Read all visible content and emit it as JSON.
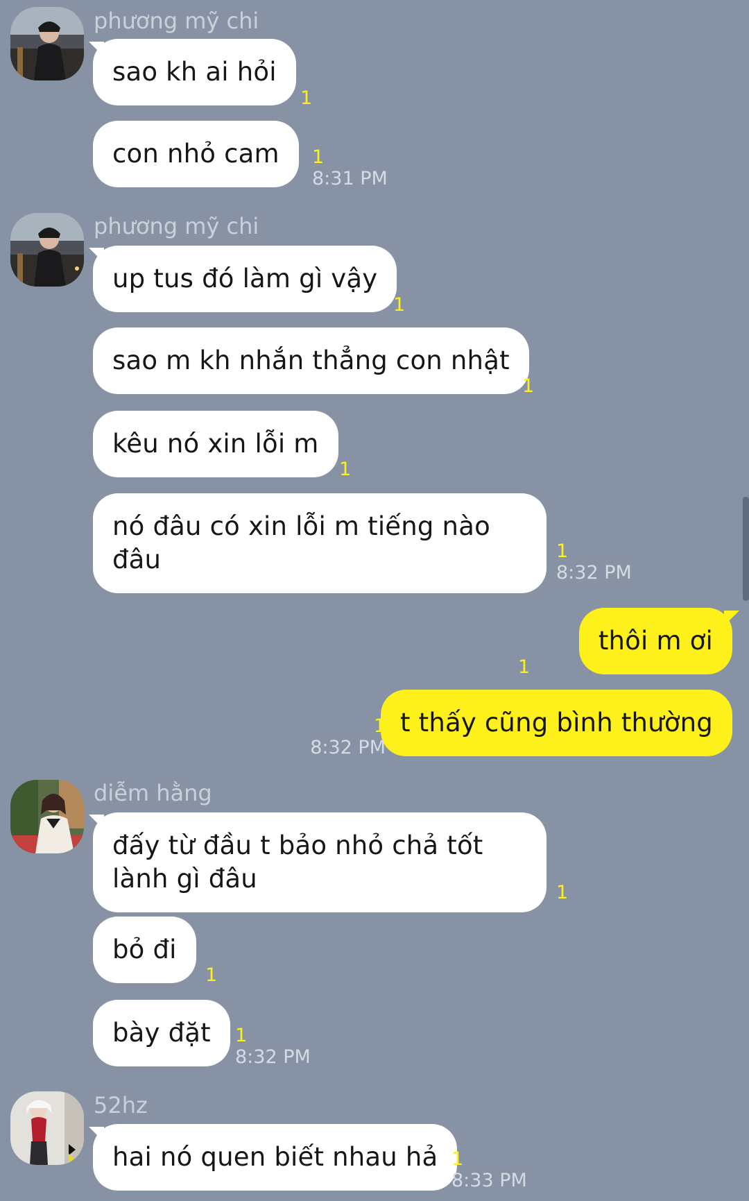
{
  "messages": [
    {
      "sender": "phương mỹ chi",
      "bubbles": [
        {
          "text": "sao kh ai hỏi",
          "unread": "1"
        },
        {
          "text": "con nhỏ cam",
          "unread": "1",
          "time": "8:31 PM"
        }
      ]
    },
    {
      "sender": "phương mỹ chi",
      "bubbles": [
        {
          "text": "up tus đó làm gì vậy",
          "unread": "1"
        },
        {
          "text": "sao m kh nhắn thẳng con nhật",
          "unread": "1"
        },
        {
          "text": "kêu nó xin lỗi m",
          "unread": "1"
        },
        {
          "text": "nó đâu có xin lỗi m tiếng nào đâu",
          "unread": "1",
          "time": "8:32 PM"
        }
      ]
    },
    {
      "sender": "me",
      "bubbles": [
        {
          "text": "thôi m ơi",
          "unread": "1"
        },
        {
          "text": "t thấy cũng bình thường",
          "unread": "1",
          "time": "8:32 PM"
        }
      ]
    },
    {
      "sender": "diễm hằng",
      "bubbles": [
        {
          "text": "đấy từ đầu t bảo nhỏ chả tốt lành gì đâu",
          "unread": "1"
        },
        {
          "text": "bỏ đi",
          "unread": "1"
        },
        {
          "text": "bày đặt",
          "unread": "1",
          "time": "8:32 PM"
        }
      ]
    },
    {
      "sender": "52hz",
      "bubbles": [
        {
          "text": "hai nó quen biết nhau hả",
          "unread": "1",
          "time": "8:33 PM"
        }
      ]
    }
  ],
  "avatars": {
    "group1": "profile-photo-icon",
    "group2": "profile-photo-icon",
    "group4": "profile-photo-icon",
    "group5": "profile-photo-icon"
  },
  "colors": {
    "background": "#8793a4",
    "incoming_bubble": "#ffffff",
    "outgoing_bubble": "#fef01b",
    "unread_count": "#fef01b"
  }
}
